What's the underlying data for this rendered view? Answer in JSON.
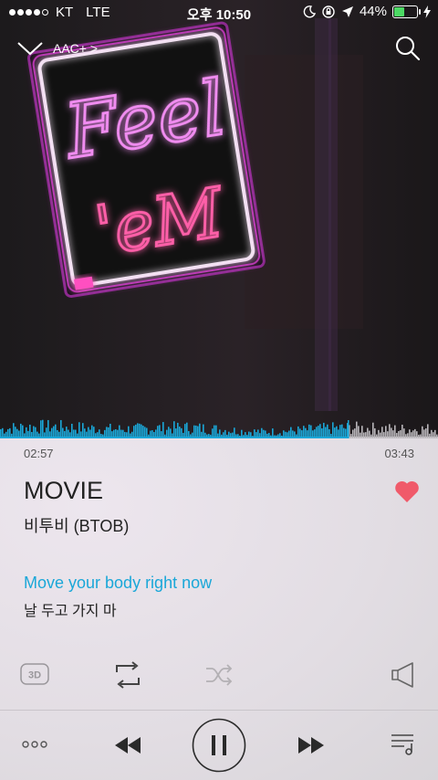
{
  "status_bar": {
    "carrier": "KT",
    "network": "LTE",
    "time": "오후 10:50",
    "battery_percent": "44%",
    "battery_level": 0.44,
    "signal_bars": 4
  },
  "nav": {
    "quality_label": "AAC+ >"
  },
  "artwork": {
    "sign_line1": "Feel",
    "sign_line2": "'eM"
  },
  "player": {
    "elapsed": "02:57",
    "total": "03:43",
    "progress": 0.794,
    "title": "MOVIE",
    "artist": "비투비 (BTOB)",
    "liked": true,
    "lyric_current": "Move your body right now",
    "lyric_next": "날 두고 가지 마",
    "btn_3d_label": "3D"
  },
  "colors": {
    "accent": "#1aa7d8",
    "heart": "#f05a6a",
    "waveform_played": "#1aa7d8",
    "waveform_remaining": "#b9b6ba",
    "neon_pink": "#e040d8"
  },
  "icons": {
    "collapse": "chevron-down-icon",
    "search": "search-icon",
    "like": "heart-icon",
    "mode_3d": "3d-icon",
    "repeat": "repeat-icon",
    "shuffle": "shuffle-icon",
    "volume": "speaker-icon",
    "more": "more-icon",
    "prev": "rewind-icon",
    "pause": "pause-icon",
    "next": "fast-forward-icon",
    "playlist": "playlist-icon"
  }
}
